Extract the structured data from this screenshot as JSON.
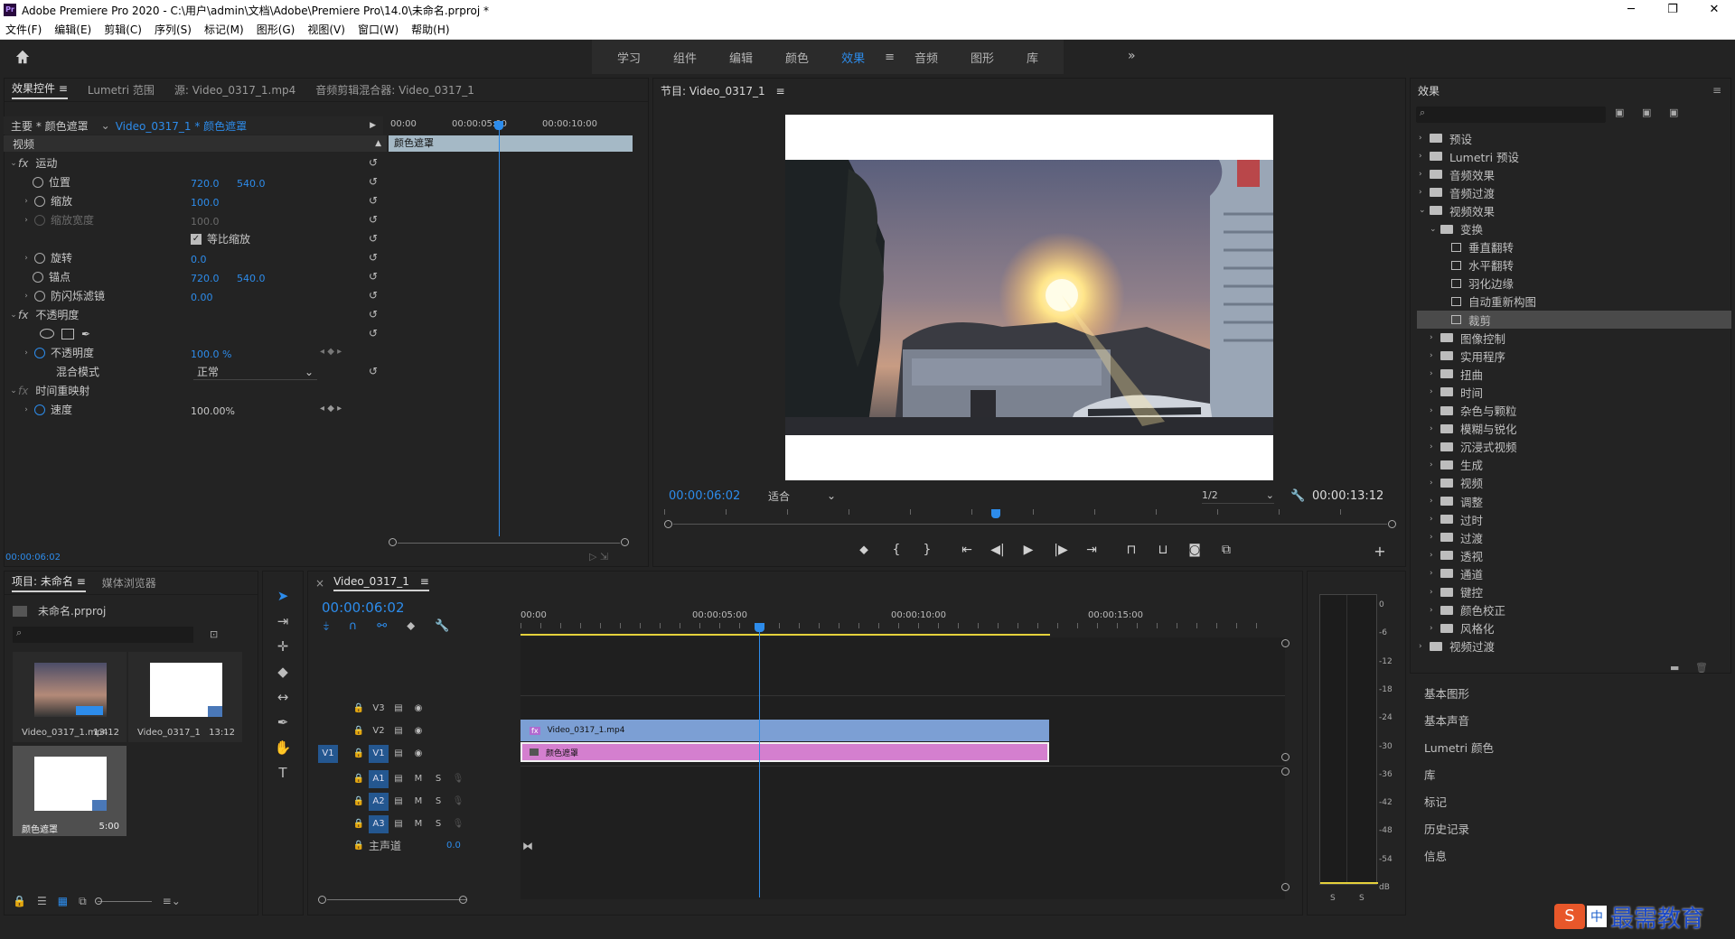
{
  "window": {
    "title": "Adobe Premiere Pro 2020 - C:\\用户\\admin\\文档\\Adobe\\Premiere Pro\\14.0\\未命名.prproj *",
    "logo": "Pr",
    "buttons": [
      "─",
      "❐",
      "✕"
    ]
  },
  "menu": [
    "文件(F)",
    "编辑(E)",
    "剪辑(C)",
    "序列(S)",
    "标记(M)",
    "图形(G)",
    "视图(V)",
    "窗口(W)",
    "帮助(H)"
  ],
  "workspaces": {
    "items": [
      "学习",
      "组件",
      "编辑",
      "颜色",
      "效果",
      "音频",
      "图形",
      "库"
    ],
    "active": "效果",
    "menu_glyph": "≡",
    "overflow": "»"
  },
  "effect_controls": {
    "tabs": [
      "效果控件",
      "Lumetri 范围",
      "源: Video_0317_1.mp4",
      "音频剪辑混合器: Video_0317_1"
    ],
    "tab_menu": "≡",
    "master": "主要 * 颜色遮罩",
    "clip": "Video_0317_1 * 颜色遮罩",
    "ruler": [
      "00:00",
      "00:00:05:00",
      "00:00:10:00"
    ],
    "clip_bar": "颜色遮罩",
    "section": "视频",
    "motion": "运动",
    "position_label": "位置",
    "position_x": "720.0",
    "position_y": "540.0",
    "scale_label": "缩放",
    "scale_val": "100.0",
    "scale_width_label": "缩放宽度",
    "scale_width_val": "100.0",
    "uniform_label": "等比缩放",
    "rotation_label": "旋转",
    "rotation_val": "0.0",
    "anchor_label": "锚点",
    "anchor_x": "720.0",
    "anchor_y": "540.0",
    "flicker_label": "防闪烁滤镜",
    "flicker_val": "0.00",
    "opacity_section": "不透明度",
    "opacity_label": "不透明度",
    "opacity_val": "100.0 %",
    "blend_label": "混合模式",
    "blend_val": "正常",
    "time_remap": "时间重映射",
    "speed_label": "速度",
    "speed_val": "100.00%",
    "timecode": "00:00:06:02"
  },
  "program": {
    "title": "节目: Video_0317_1",
    "menu": "≡",
    "timecode": "00:00:06:02",
    "fit": "适合",
    "quality": "1/2",
    "duration": "00:00:13:12"
  },
  "effects": {
    "title": "效果",
    "menu": "≡",
    "items": [
      {
        "label": "预设",
        "level": 0,
        "open": false,
        "type": "folder"
      },
      {
        "label": "Lumetri 预设",
        "level": 0,
        "open": false,
        "type": "folder"
      },
      {
        "label": "音频效果",
        "level": 0,
        "open": false,
        "type": "folder"
      },
      {
        "label": "音频过渡",
        "level": 0,
        "open": false,
        "type": "folder"
      },
      {
        "label": "视频效果",
        "level": 0,
        "open": true,
        "type": "folder"
      },
      {
        "label": "变换",
        "level": 1,
        "open": true,
        "type": "folder"
      },
      {
        "label": "垂直翻转",
        "level": 2,
        "type": "fx"
      },
      {
        "label": "水平翻转",
        "level": 2,
        "type": "fx"
      },
      {
        "label": "羽化边缘",
        "level": 2,
        "type": "fx"
      },
      {
        "label": "自动重新构图",
        "level": 2,
        "type": "fx"
      },
      {
        "label": "裁剪",
        "level": 2,
        "type": "fx",
        "selected": true
      },
      {
        "label": "图像控制",
        "level": 1,
        "open": false,
        "type": "folder"
      },
      {
        "label": "实用程序",
        "level": 1,
        "open": false,
        "type": "folder"
      },
      {
        "label": "扭曲",
        "level": 1,
        "open": false,
        "type": "folder"
      },
      {
        "label": "时间",
        "level": 1,
        "open": false,
        "type": "folder"
      },
      {
        "label": "杂色与颗粒",
        "level": 1,
        "open": false,
        "type": "folder"
      },
      {
        "label": "模糊与锐化",
        "level": 1,
        "open": false,
        "type": "folder"
      },
      {
        "label": "沉浸式视频",
        "level": 1,
        "open": false,
        "type": "folder"
      },
      {
        "label": "生成",
        "level": 1,
        "open": false,
        "type": "folder"
      },
      {
        "label": "视频",
        "level": 1,
        "open": false,
        "type": "folder"
      },
      {
        "label": "调整",
        "level": 1,
        "open": false,
        "type": "folder"
      },
      {
        "label": "过时",
        "level": 1,
        "open": false,
        "type": "folder"
      },
      {
        "label": "过渡",
        "level": 1,
        "open": false,
        "type": "folder"
      },
      {
        "label": "透视",
        "level": 1,
        "open": false,
        "type": "folder"
      },
      {
        "label": "通道",
        "level": 1,
        "open": false,
        "type": "folder"
      },
      {
        "label": "键控",
        "level": 1,
        "open": false,
        "type": "folder"
      },
      {
        "label": "颜色校正",
        "level": 1,
        "open": false,
        "type": "folder"
      },
      {
        "label": "风格化",
        "level": 1,
        "open": false,
        "type": "folder"
      },
      {
        "label": "视频过渡",
        "level": 0,
        "open": false,
        "type": "folder"
      }
    ],
    "side_panels": [
      "基本图形",
      "基本声音",
      "Lumetri 颜色",
      "库",
      "标记",
      "历史记录",
      "信息"
    ]
  },
  "project": {
    "tabs": [
      "项目: 未命名",
      "媒体浏览器"
    ],
    "menu": "≡",
    "file": "未命名.prproj",
    "items": [
      {
        "name": "Video_0317_1.mp4",
        "dur": "13:12"
      },
      {
        "name": "Video_0317_1",
        "dur": "13:12"
      },
      {
        "name": "颜色遮罩",
        "dur": "5:00"
      }
    ]
  },
  "timeline": {
    "tab": "Video_0317_1",
    "close": "×",
    "menu": "≡",
    "timecode": "00:00:06:02",
    "ruler": [
      "00:00",
      "00:00:05:00",
      "00:00:10:00",
      "00:00:15:00"
    ],
    "video_tracks": [
      "V3",
      "V2",
      "V1"
    ],
    "audio_tracks": [
      "A1",
      "A2",
      "A3"
    ],
    "src_v": "V1",
    "master": "主声道",
    "master_val": "0.0",
    "clip_video": "Video_0317_1.mp4",
    "clip_matte": "颜色遮罩",
    "m": "M",
    "s": "S",
    "fx": "fx"
  },
  "meter": {
    "labels": [
      "0",
      "-6",
      "-12",
      "-18",
      "-24",
      "-30",
      "-36",
      "-42",
      "-48",
      "-54",
      "dB"
    ],
    "solo": [
      "S",
      "S"
    ]
  },
  "watermark": "中",
  "watermark2": "最需教育"
}
